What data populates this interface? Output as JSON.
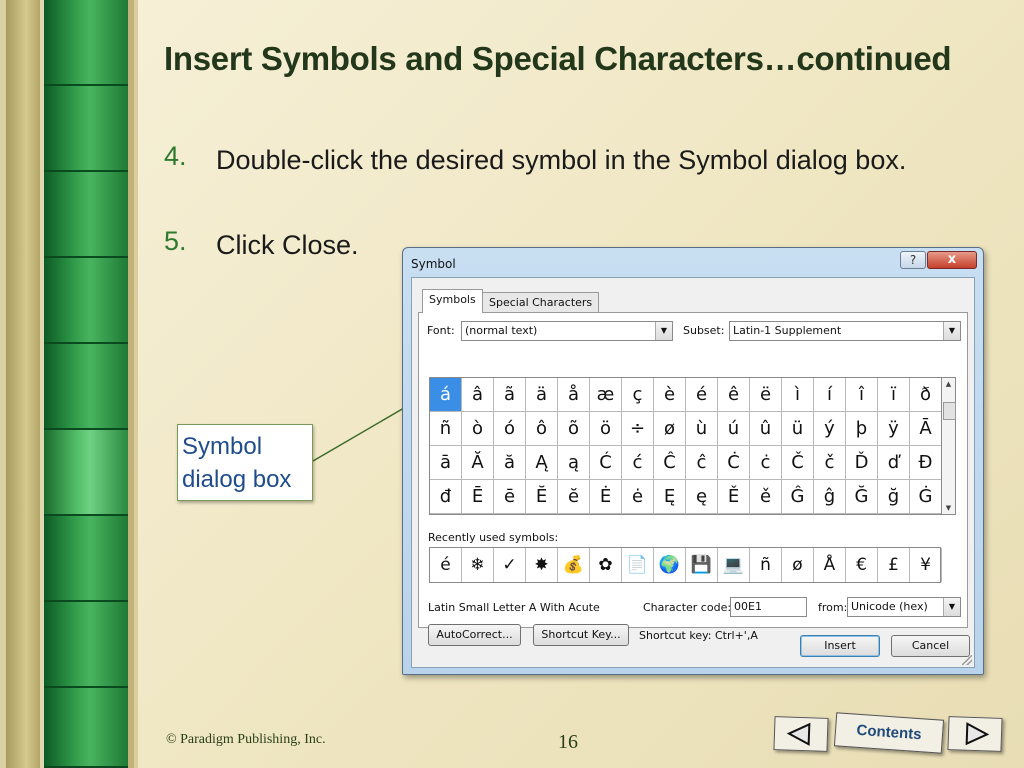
{
  "slide": {
    "title": "Insert Symbols and Special Characters…continued",
    "steps": [
      {
        "num": "4.",
        "text": "Double-click the desired symbol in the Symbol dialog box."
      },
      {
        "num": "5.",
        "text": "Click Close."
      }
    ],
    "callout": "Symbol dialog box",
    "footer": "© Paradigm Publishing, Inc.",
    "page_number": "16",
    "nav": {
      "prev_icon": "left-arrow-icon",
      "contents_label": "Contents",
      "next_icon": "right-arrow-icon"
    }
  },
  "dialog": {
    "title": "Symbol",
    "help_label": "?",
    "close_label": "x",
    "tabs": [
      "Symbols",
      "Special Characters"
    ],
    "font_label": "Font:",
    "font_value": "(normal text)",
    "subset_label": "Subset:",
    "subset_value": "Latin-1 Supplement",
    "grid": [
      [
        "á",
        "â",
        "ã",
        "ä",
        "å",
        "æ",
        "ç",
        "è",
        "é",
        "ê",
        "ë",
        "ì",
        "í",
        "î",
        "ï",
        "ð"
      ],
      [
        "ñ",
        "ò",
        "ó",
        "ô",
        "õ",
        "ö",
        "÷",
        "ø",
        "ù",
        "ú",
        "û",
        "ü",
        "ý",
        "þ",
        "ÿ",
        "Ā"
      ],
      [
        "ā",
        "Ă",
        "ă",
        "Ą",
        "ą",
        "Ć",
        "ć",
        "Ĉ",
        "ĉ",
        "Ċ",
        "ċ",
        "Č",
        "č",
        "Ď",
        "ď",
        "Đ"
      ],
      [
        "đ",
        "Ē",
        "ē",
        "Ĕ",
        "ĕ",
        "Ė",
        "ė",
        "Ę",
        "ę",
        "Ě",
        "ě",
        "Ĝ",
        "ĝ",
        "Ğ",
        "ğ",
        "Ġ"
      ]
    ],
    "selected_char": "á",
    "recent_label": "Recently used symbols:",
    "recent": [
      "é",
      "❄",
      "✓",
      "✸",
      "💰",
      "✿",
      "📄",
      "🌍",
      "💾",
      "💻",
      "ñ",
      "ø",
      "Å",
      "€",
      "£",
      "¥"
    ],
    "char_name": "Latin Small Letter A With Acute",
    "char_code_label": "Character code:",
    "char_code": "00E1",
    "from_label": "from:",
    "from_value": "Unicode (hex)",
    "autocorrect_label": "AutoCorrect...",
    "shortcut_key_label": "Shortcut Key...",
    "shortcut_text": "Shortcut key: Ctrl+',A",
    "insert_label": "Insert",
    "cancel_label": "Cancel"
  },
  "colors": {
    "title": "#23371b",
    "step_number": "#2d7a2f",
    "callout_text": "#1f4d8c",
    "selected_cell": "#3a8ee6"
  }
}
